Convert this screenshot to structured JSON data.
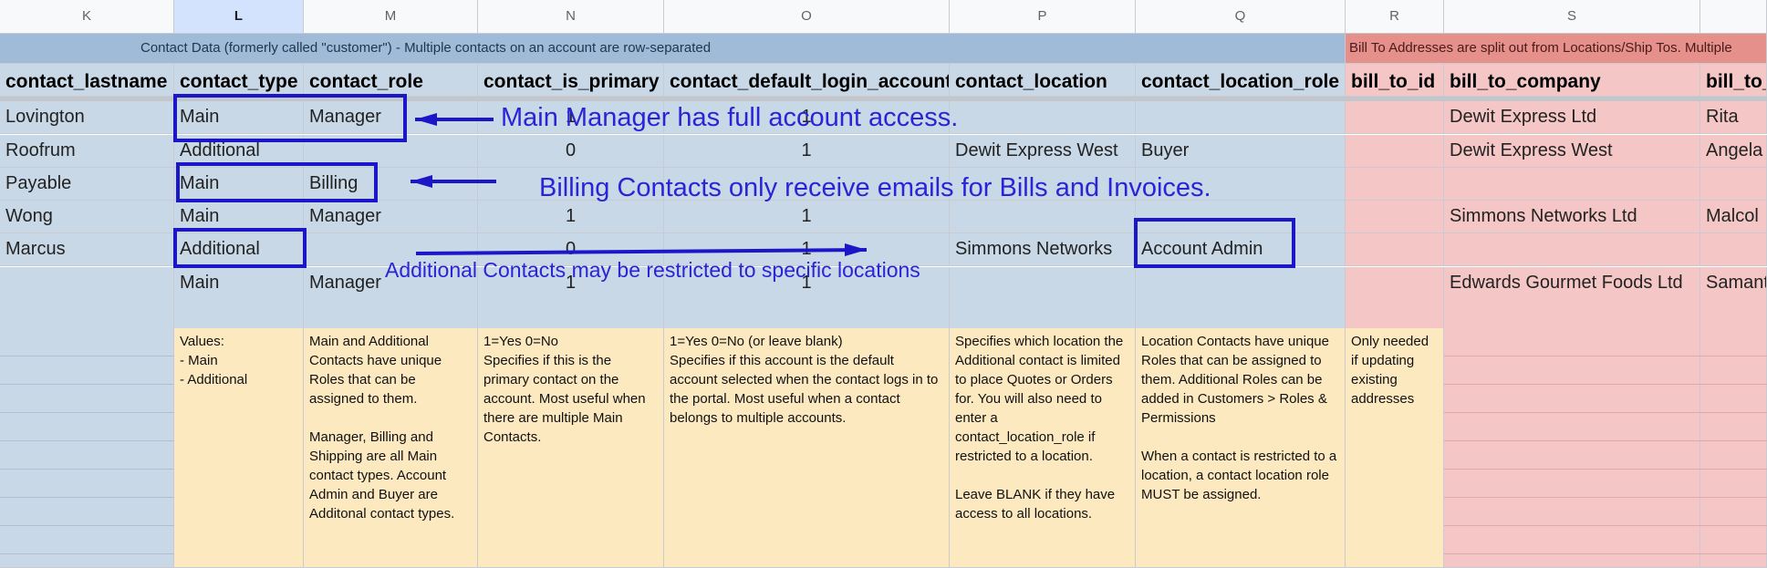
{
  "columns": [
    "K",
    "L",
    "M",
    "N",
    "O",
    "P",
    "Q",
    "R",
    "S",
    ""
  ],
  "selected_column": "L",
  "banners": {
    "contact": "Contact Data (formerly called \"customer\") - Multiple contacts on an account are row-separated",
    "billto": "Bill To Addresses are split out from Locations/Ship Tos. Multiple"
  },
  "headers": [
    "contact_lastname",
    "contact_type",
    "contact_role",
    "contact_is_primary",
    "contact_default_login_account",
    "contact_location",
    "contact_location_role",
    "bill_to_id",
    "bill_to_company",
    "bill_to_"
  ],
  "rows": [
    [
      "Lovington",
      "Main",
      "Manager",
      "1",
      "1",
      "",
      "",
      "",
      "Dewit Express Ltd",
      "Rita"
    ],
    [
      "Roofrum",
      "Additional",
      "",
      "0",
      "1",
      "Dewit Express West",
      "Buyer",
      "",
      "Dewit Express West",
      "Angela"
    ],
    [
      "Payable",
      "Main",
      "Billing",
      "",
      "",
      "",
      "",
      "",
      "",
      ""
    ],
    [
      "Wong",
      "Main",
      "Manager",
      "1",
      "1",
      "",
      "",
      "",
      "Simmons Networks Ltd",
      "Malcol"
    ],
    [
      "Marcus",
      "Additional",
      "",
      "0",
      "1",
      "Simmons Networks",
      "Account Admin",
      "",
      "",
      ""
    ],
    [
      "",
      "Main",
      "Manager",
      "1",
      "1",
      "",
      "",
      "",
      "Edwards Gourmet Foods Ltd",
      "Samant"
    ],
    [
      "",
      "",
      "",
      "",
      "",
      "",
      "",
      "",
      "",
      ""
    ]
  ],
  "notes": {
    "contact_type": [
      "Values:\n- Main\n- Additional"
    ],
    "contact_role": [
      "Main and Additional Contacts have unique Roles that can be assigned to them.",
      "Manager, Billing and Shipping are all Main contact types. Account Admin and Buyer are Additonal contact types."
    ],
    "contact_is_primary": [
      "1=Yes   0=No\nSpecifies if this is the primary contact on the account. Most useful when there are multiple Main Contacts."
    ],
    "contact_default_login_account": [
      "1=Yes   0=No (or leave blank)\nSpecifies if this account is the default account selected when the contact logs in to the portal. Most useful when a contact belongs to multiple accounts."
    ],
    "contact_location": [
      "Specifies which location the Additional contact is limited to place Quotes or Orders for. You will also need to enter a contact_location_role if restricted to a location.",
      "Leave BLANK if they have access to all locations."
    ],
    "contact_location_role": [
      "Location Contacts have unique Roles that can be assigned to them. Additional Roles can be added in Customers > Roles & Permissions",
      "When a contact is restricted to a location, a contact location role MUST be assigned."
    ],
    "bill_to_id": [
      "Only needed if updating existing addresses"
    ]
  },
  "annotations": {
    "main_manager": "Main Manager has full account access.",
    "billing": "Billing Contacts only receive emails for Bills and Invoices.",
    "additional": "Additional Contacts may be restricted to specific locations"
  },
  "colors": {
    "contact_band": "#9fbbd8",
    "contact_fill": "#c9d8e7",
    "billto_band": "#e6908c",
    "billto_fill": "#f4c7c6",
    "note_fill": "#fde9c0",
    "annotation_blue": "#1c16c9"
  }
}
